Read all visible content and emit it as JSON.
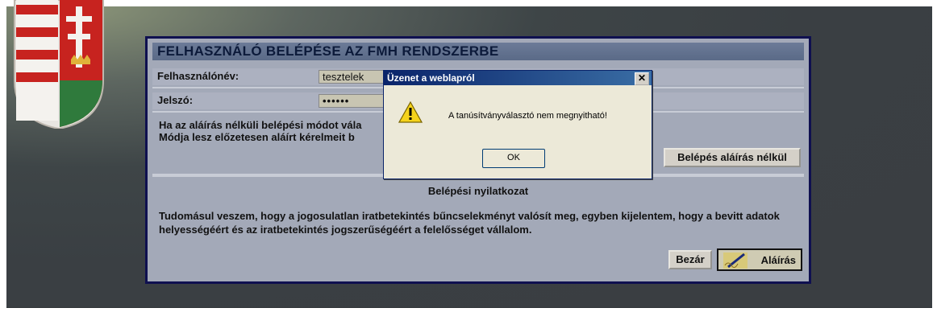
{
  "login": {
    "title": "FELHASZNÁLÓ BELÉPÉSE AZ FMH RENDSZERBE",
    "username_label": "Felhasználónév:",
    "username_value": "tesztelek",
    "password_label": "Jelszó:",
    "password_value": "••••••",
    "info_line1": "Ha az aláírás nélküli belépési módot vála",
    "info_line2": "Módja lesz előzetesen aláírt kérelmeit b",
    "no_signature_button": "Belépés aláírás nélkül",
    "declaration_title": "Belépési nyilatkozat",
    "declaration_text": "Tudomásul veszem, hogy a jogosulatlan iratbetekintés bűncselekményt valósít meg, egyben kijelentem, hogy a bevitt adatok helyességéért és az iratbetekintés jogszerűségéért a felelősséget vállalom.",
    "close_button": "Bezár",
    "sign_button": "Aláírás"
  },
  "dialog": {
    "title": "Üzenet a weblapról",
    "close_glyph": "✕",
    "message": "A tanúsítványválasztó nem megnyitható!",
    "ok_button": "OK",
    "icon": "warning-icon"
  },
  "colors": {
    "panel_border": "#0f1050",
    "title_bar": "#5a6a87",
    "dialog_title": "#0a246a"
  }
}
